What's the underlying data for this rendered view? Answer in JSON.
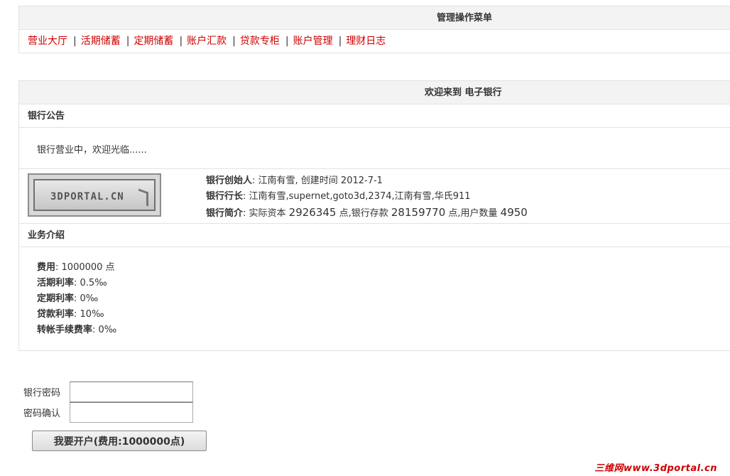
{
  "menu": {
    "title": "管理操作菜单",
    "items": [
      "营业大厅",
      "活期储蓄",
      "定期储蓄",
      "账户汇款",
      "贷款专柜",
      "账户管理",
      "理财日志"
    ],
    "separator": "|"
  },
  "welcome": {
    "title": "欢迎来到 电子银行",
    "notice_heading": "银行公告",
    "notice_text": "银行营业中，欢迎光临......",
    "logo_text": "3DPORTAL.CN",
    "founder_label": "银行创始人",
    "founder_value": ": 江南有雪, 创建时间 2012-7-1",
    "president_label": "银行行长",
    "president_value": ": 江南有雪,supernet,goto3d,2374,江南有雪,华氏911",
    "intro_label": "银行简介",
    "intro_prefix": ": 实际资本 ",
    "capital": "2926345",
    "intro_mid": " 点,银行存款 ",
    "deposits": "28159770",
    "intro_mid2": " 点,用户数量 ",
    "users": "4950"
  },
  "business": {
    "heading": "业务介绍",
    "fee_label": "费用",
    "fee_value": ": 1000000 点",
    "demand_label": "活期利率",
    "demand_value": ": 0.5‰",
    "fixed_label": "定期利率",
    "fixed_value": ": 0‰",
    "loan_label": "贷款利率",
    "loan_value": ": 10‰",
    "transfer_label": "转帐手续费率",
    "transfer_value": ": 0‰"
  },
  "form": {
    "password_label": "银行密码",
    "confirm_label": "密码确认",
    "password_value": "",
    "confirm_value": "",
    "submit_label": "我要开户(费用:1000000点)"
  },
  "watermark": "三维网www.3dportal.cn",
  "colors": {
    "link": "#cc0000",
    "header_bg": "#f3f3f3",
    "border": "#e2e2e2"
  }
}
